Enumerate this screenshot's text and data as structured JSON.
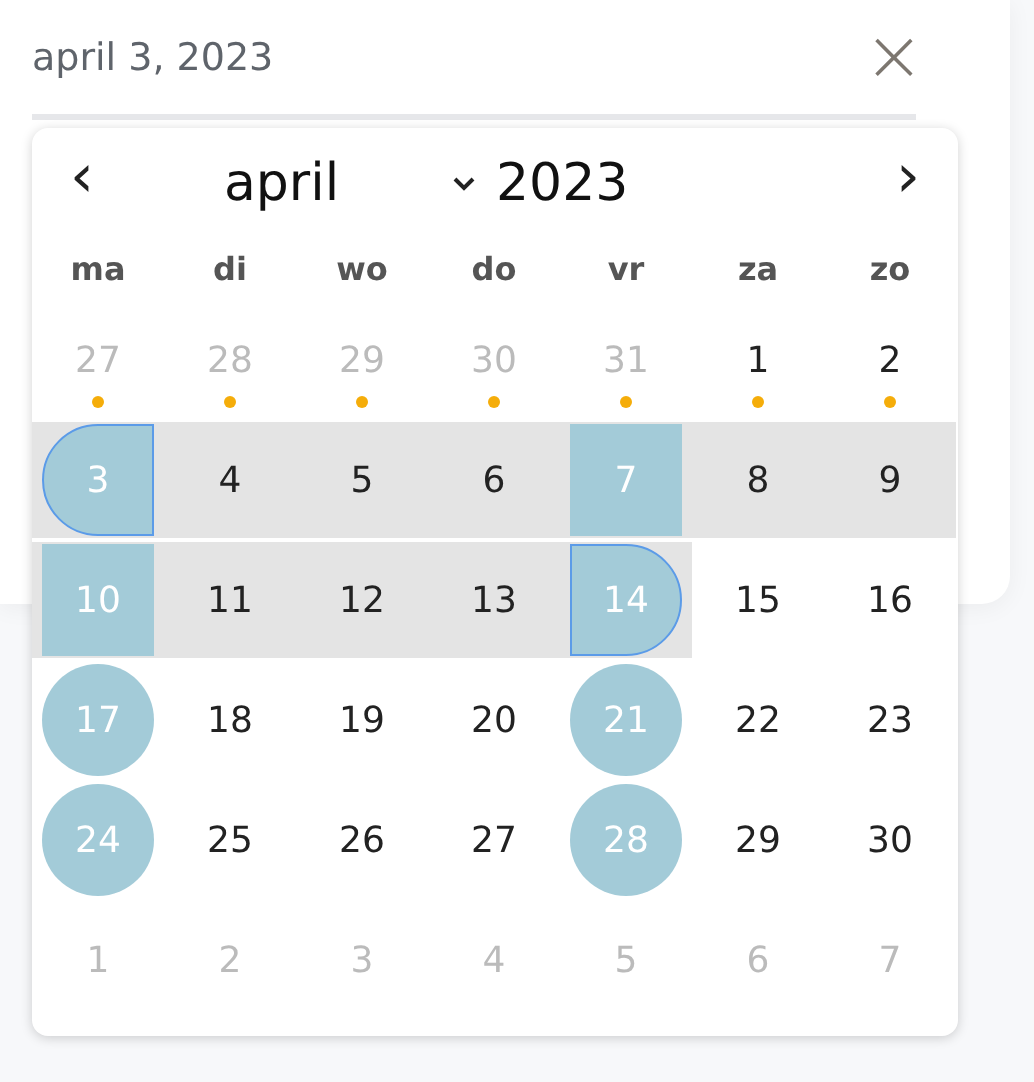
{
  "date_field": {
    "value": "april 3, 2023",
    "clear": "×"
  },
  "calendar": {
    "prev": "‹",
    "month": "april",
    "year": "2023",
    "next": "›",
    "weekdays": [
      "ma",
      "di",
      "wo",
      "do",
      "vr",
      "za",
      "zo"
    ],
    "weeks": [
      [
        {
          "day": "27",
          "muted": true,
          "dot": true,
          "kind": "plain"
        },
        {
          "day": "28",
          "muted": true,
          "dot": true,
          "kind": "plain"
        },
        {
          "day": "29",
          "muted": true,
          "dot": true,
          "kind": "plain"
        },
        {
          "day": "30",
          "muted": true,
          "dot": true,
          "kind": "plain"
        },
        {
          "day": "31",
          "muted": true,
          "dot": true,
          "kind": "plain"
        },
        {
          "day": "1",
          "muted": false,
          "dot": true,
          "kind": "plain"
        },
        {
          "day": "2",
          "muted": false,
          "dot": true,
          "kind": "plain"
        }
      ],
      [
        {
          "day": "3",
          "muted": false,
          "dot": false,
          "kind": "start"
        },
        {
          "day": "4",
          "muted": false,
          "dot": false,
          "kind": "range"
        },
        {
          "day": "5",
          "muted": false,
          "dot": false,
          "kind": "range"
        },
        {
          "day": "6",
          "muted": false,
          "dot": false,
          "kind": "range"
        },
        {
          "day": "7",
          "muted": false,
          "dot": false,
          "kind": "block"
        },
        {
          "day": "8",
          "muted": false,
          "dot": false,
          "kind": "range"
        },
        {
          "day": "9",
          "muted": false,
          "dot": false,
          "kind": "range"
        }
      ],
      [
        {
          "day": "10",
          "muted": false,
          "dot": false,
          "kind": "block"
        },
        {
          "day": "11",
          "muted": false,
          "dot": false,
          "kind": "range"
        },
        {
          "day": "12",
          "muted": false,
          "dot": false,
          "kind": "range"
        },
        {
          "day": "13",
          "muted": false,
          "dot": false,
          "kind": "range"
        },
        {
          "day": "14",
          "muted": false,
          "dot": false,
          "kind": "end"
        },
        {
          "day": "15",
          "muted": false,
          "dot": false,
          "kind": "plain"
        },
        {
          "day": "16",
          "muted": false,
          "dot": false,
          "kind": "plain"
        }
      ],
      [
        {
          "day": "17",
          "muted": false,
          "dot": false,
          "kind": "circle"
        },
        {
          "day": "18",
          "muted": false,
          "dot": false,
          "kind": "plain"
        },
        {
          "day": "19",
          "muted": false,
          "dot": false,
          "kind": "plain"
        },
        {
          "day": "20",
          "muted": false,
          "dot": false,
          "kind": "plain"
        },
        {
          "day": "21",
          "muted": false,
          "dot": false,
          "kind": "circle"
        },
        {
          "day": "22",
          "muted": false,
          "dot": false,
          "kind": "plain"
        },
        {
          "day": "23",
          "muted": false,
          "dot": false,
          "kind": "plain"
        }
      ],
      [
        {
          "day": "24",
          "muted": false,
          "dot": false,
          "kind": "circle"
        },
        {
          "day": "25",
          "muted": false,
          "dot": false,
          "kind": "plain"
        },
        {
          "day": "26",
          "muted": false,
          "dot": false,
          "kind": "plain"
        },
        {
          "day": "27",
          "muted": false,
          "dot": false,
          "kind": "plain"
        },
        {
          "day": "28",
          "muted": false,
          "dot": false,
          "kind": "circle"
        },
        {
          "day": "29",
          "muted": false,
          "dot": false,
          "kind": "plain"
        },
        {
          "day": "30",
          "muted": false,
          "dot": false,
          "kind": "plain"
        }
      ],
      [
        {
          "day": "1",
          "muted": true,
          "dot": false,
          "kind": "plain"
        },
        {
          "day": "2",
          "muted": true,
          "dot": false,
          "kind": "plain"
        },
        {
          "day": "3",
          "muted": true,
          "dot": false,
          "kind": "plain"
        },
        {
          "day": "4",
          "muted": true,
          "dot": false,
          "kind": "plain"
        },
        {
          "day": "5",
          "muted": true,
          "dot": false,
          "kind": "plain"
        },
        {
          "day": "6",
          "muted": true,
          "dot": false,
          "kind": "plain"
        },
        {
          "day": "7",
          "muted": true,
          "dot": false,
          "kind": "plain"
        }
      ]
    ]
  }
}
